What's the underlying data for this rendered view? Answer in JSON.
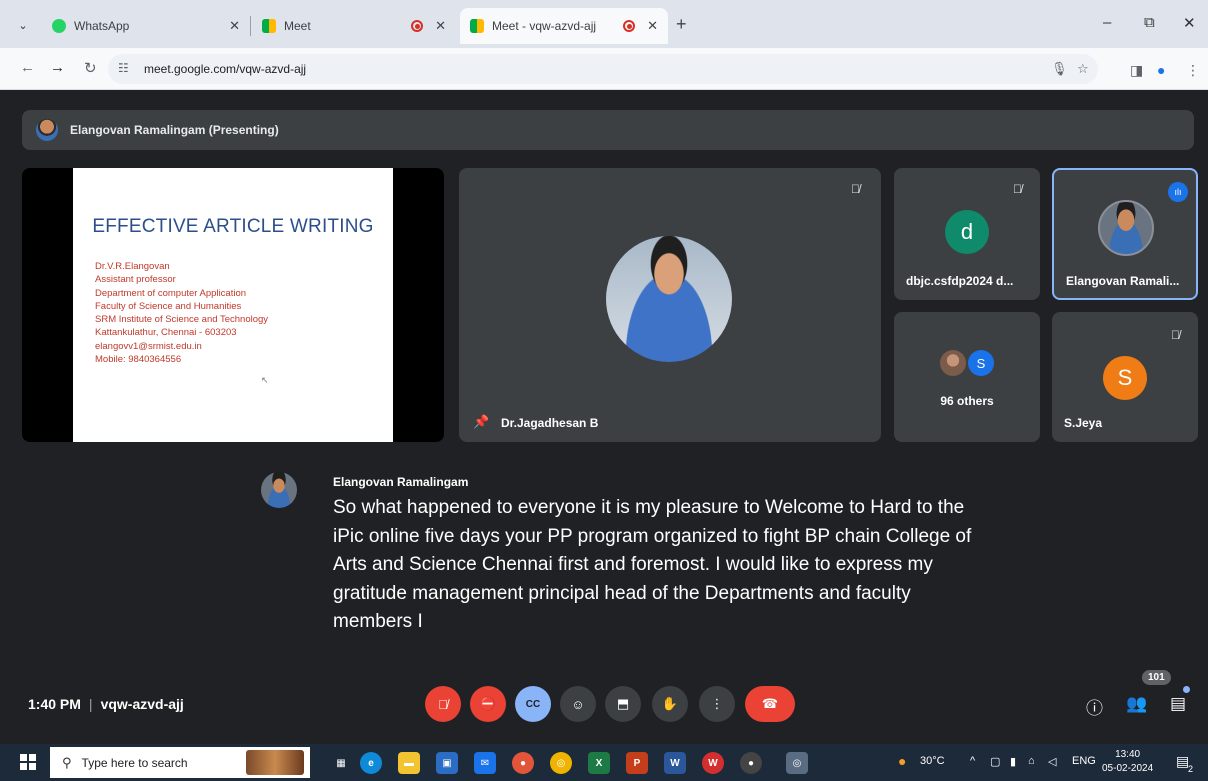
{
  "browser": {
    "tabs": [
      {
        "label": "WhatsApp",
        "active": false
      },
      {
        "label": "Meet",
        "active": false
      },
      {
        "label": "Meet - vqw-azvd-ajj",
        "active": true
      }
    ],
    "new_tab": "+",
    "window_controls": {
      "minimize": "–",
      "restore": "⧉",
      "close": "✕"
    },
    "url": "meet.google.com/vqw-azvd-ajj"
  },
  "meet": {
    "presenting_label": "Elangovan Ramalingam (Presenting)",
    "slide": {
      "title": "EFFECTIVE ARTICLE WRITING",
      "lines": [
        "Dr.V.R.Elangovan",
        "Assistant professor",
        "Department of computer Application",
        "Faculty of Science and Humanities",
        "SRM Institute of Science and Technology",
        "Kattankulathur, Chennai - 603203",
        "elangovv1@srmist.edu.in",
        "Mobile: 9840364556"
      ]
    },
    "participants": {
      "speaker": "Dr.Jagadhesan B",
      "dbjc": {
        "initial": "d",
        "name": "dbjc.csfdp2024 d..."
      },
      "elangovan": {
        "name": "Elangovan Ramali..."
      },
      "others": {
        "label": "96 others",
        "initial": "S"
      },
      "sjeya": {
        "initial": "S",
        "name": "S.Jeya"
      }
    },
    "caption": {
      "speaker": "Elangovan Ramalingam",
      "text": "So what happened to everyone it is my pleasure to Welcome to Hard to the iPic online five days your PP program organized to fight BP chain College of Arts and Science Chennai first and foremost. I would like to express my gratitude management principal head of the Departments and faculty members I"
    },
    "time": "1:40 PM",
    "meeting_code": "vqw-azvd-ajj",
    "participant_count": "101",
    "colors": {
      "red": "#ea4335",
      "blue": "#8ab4f8",
      "tile": "#3c4043",
      "bg": "#202124"
    }
  },
  "taskbar": {
    "search_placeholder": "Type here to search",
    "weather": "30°C",
    "language": "ENG",
    "time": "13:40",
    "date": "05-02-2024",
    "notification_count": "2"
  }
}
